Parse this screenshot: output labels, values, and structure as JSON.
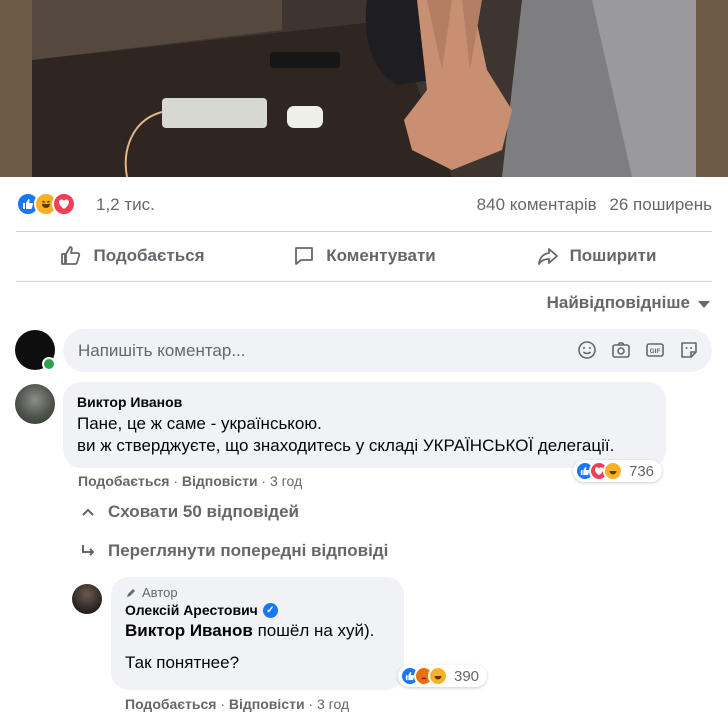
{
  "post": {
    "reactions_count": "1,2 тис.",
    "comments_count": "840 коментарів",
    "shares_count": "26 поширень",
    "reaction_types": [
      "like",
      "haha",
      "love"
    ]
  },
  "actions": {
    "like": "Подобається",
    "comment": "Коментувати",
    "share": "Поширити"
  },
  "sort": {
    "label": "Найвідповідніше"
  },
  "composer": {
    "placeholder": "Напишіть коментар..."
  },
  "comments": [
    {
      "author": "Виктор Иванов",
      "line1": "Пане, це ж саме - українською.",
      "line2": "ви ж стверджуєте, що знаходитесь у складі УКРАЇНСЬКОЇ делегації.",
      "like_label": "Подобається",
      "reply_label": "Відповісти",
      "time": "3 год",
      "reactions_count": "736",
      "reaction_types": [
        "like",
        "love",
        "haha"
      ]
    }
  ],
  "thread": {
    "hide_replies": "Сховати 50 відповідей",
    "view_previous": "Переглянути попередні відповіді"
  },
  "reply": {
    "badge": "Автор",
    "author": "Олексій Арестович",
    "mention": "Виктор Иванов",
    "text1": " пошёл на хуй).",
    "text2": "Так понятнее?",
    "like_label": "Подобається",
    "reply_label": "Відповісти",
    "time": "3 год",
    "reactions_count": "390",
    "reaction_types": [
      "like",
      "angry",
      "haha"
    ]
  },
  "colors": {
    "facebook_blue": "#1877f2",
    "secondary_text": "#65676b",
    "bubble_bg": "#f0f2f5",
    "online_green": "#31a24c"
  }
}
